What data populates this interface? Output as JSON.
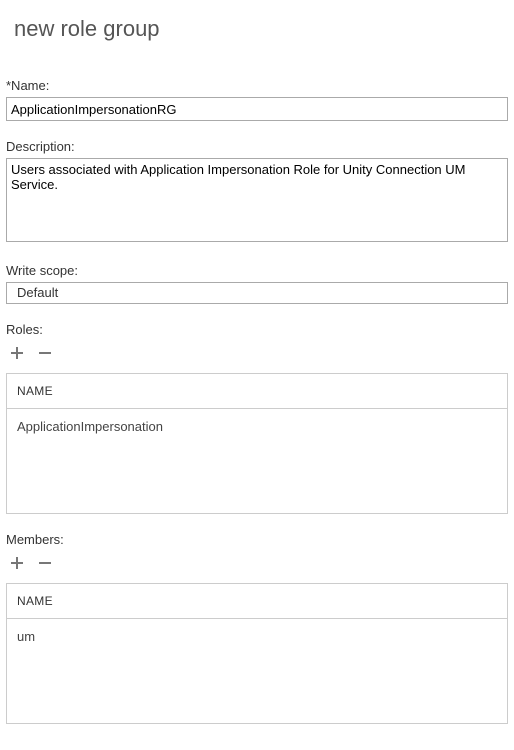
{
  "title": "new role group",
  "name": {
    "label": "*Name:",
    "value": "ApplicationImpersonationRG"
  },
  "description": {
    "label": "Description:",
    "value": "Users associated with Application Impersonation Role for Unity Connection UM Service."
  },
  "writeScope": {
    "label": "Write scope:",
    "value": "Default"
  },
  "roles": {
    "label": "Roles:",
    "header": "NAME",
    "items": [
      "ApplicationImpersonation"
    ]
  },
  "members": {
    "label": "Members:",
    "header": "NAME",
    "items": [
      "um"
    ]
  }
}
